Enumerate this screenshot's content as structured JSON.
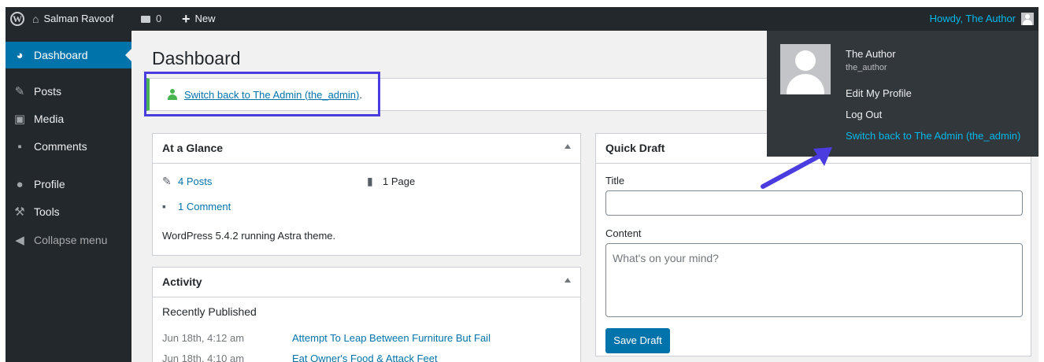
{
  "adminbar": {
    "wp_logo_icon": "wordpress-logo",
    "site_name": "Salman Ravoof",
    "comments_count": "0",
    "new_label": "New",
    "howdy": "Howdy, The Author"
  },
  "sidebar": {
    "items": [
      {
        "label": "Dashboard",
        "icon": "dashboard-icon"
      },
      {
        "label": "Posts",
        "icon": "pin-icon"
      },
      {
        "label": "Media",
        "icon": "media-icon"
      },
      {
        "label": "Comments",
        "icon": "comment-icon"
      },
      {
        "label": "Profile",
        "icon": "user-icon"
      },
      {
        "label": "Tools",
        "icon": "wrench-icon"
      },
      {
        "label": "Collapse menu",
        "icon": "collapse-icon"
      }
    ]
  },
  "main": {
    "title": "Dashboard",
    "notice": {
      "link": "Switch back to The Admin (the_admin)",
      "suffix": "."
    },
    "glance": {
      "title": "At a Glance",
      "posts": "4 Posts",
      "pages": "1 Page",
      "comments": "1 Comment",
      "version": "WordPress 5.4.2 running Astra theme."
    },
    "activity": {
      "title": "Activity",
      "subtitle": "Recently Published",
      "rows": [
        {
          "date": "Jun 18th, 4:12 am",
          "title": "Attempt To Leap Between Furniture But Fail"
        },
        {
          "date": "Jun 18th, 4:10 am",
          "title": "Eat Owner's Food & Attack Feet"
        }
      ]
    },
    "quickdraft": {
      "title": "Quick Draft",
      "title_label": "Title",
      "title_value": "",
      "content_label": "Content",
      "content_placeholder": "What's on your mind?",
      "save": "Save Draft"
    }
  },
  "dropdown": {
    "name": "The Author",
    "username": "the_author",
    "edit_profile": "Edit My Profile",
    "logout": "Log Out",
    "switch_back": "Switch back to The Admin (the_admin)"
  },
  "colors": {
    "adminbar": "#23282d",
    "accent": "#0073aa",
    "highlight": "#4b3cdf",
    "notice_green": "#46b450",
    "link_hover": "#00b9eb"
  }
}
